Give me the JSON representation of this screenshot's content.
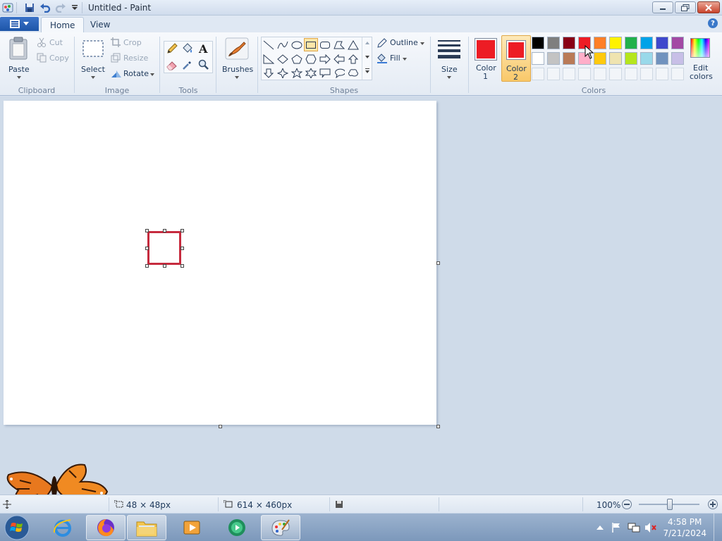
{
  "window": {
    "title": "Untitled - Paint"
  },
  "tabs": [
    {
      "label": "Home"
    },
    {
      "label": "View"
    }
  ],
  "ribbon": {
    "clipboard": {
      "label": "Clipboard",
      "paste": "Paste",
      "cut": "Cut",
      "copy": "Copy"
    },
    "image": {
      "label": "Image",
      "select": "Select",
      "crop": "Crop",
      "resize": "Resize",
      "rotate": "Rotate"
    },
    "tools": {
      "label": "Tools"
    },
    "brushes": {
      "label": "Brushes"
    },
    "shapes": {
      "label": "Shapes",
      "outline": "Outline",
      "fill": "Fill"
    },
    "size": {
      "label": "Size"
    },
    "colors": {
      "label": "Colors",
      "color1_label": "Color",
      "color1_num": "1",
      "color2_label": "Color",
      "color2_num": "2",
      "edit_label": "Edit",
      "edit_label2": "colors",
      "color1": "#ed1c24",
      "color2": "#ed1c24",
      "palette_row1": [
        "#000000",
        "#7f7f7f",
        "#880015",
        "#ed1c24",
        "#ff7f27",
        "#fff200",
        "#22b14c",
        "#00a2e8",
        "#3f48cc",
        "#a349a4"
      ],
      "palette_row2": [
        "#ffffff",
        "#c3c3c3",
        "#b97a57",
        "#ffaec9",
        "#ffc90e",
        "#efe4b0",
        "#b5e61d",
        "#99d9ea",
        "#7092be",
        "#c8bfe7"
      ]
    }
  },
  "status": {
    "selection_size": "48 × 48px",
    "canvas_size": "614 × 460px",
    "zoom": "100%"
  },
  "taskbar": {
    "time": "4:58 PM",
    "date": "7/21/2024"
  }
}
